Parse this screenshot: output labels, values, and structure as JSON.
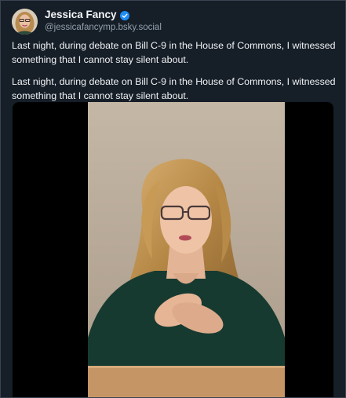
{
  "post": {
    "author": {
      "display_name": "Jessica Fancy",
      "handle": "@jessicafancymp.bsky.social",
      "verified": true
    },
    "paragraphs": [
      "Last night, during debate on Bill C-9 in the House of Commons, I witnessed something that I cannot stay silent about.",
      "Last night, during debate on Bill C-9 in the House of Commons, I witnessed something that I cannot stay silent about."
    ],
    "media": {
      "type": "video",
      "icon": "video-player"
    }
  },
  "colors": {
    "background": "#161e27",
    "text": "#f1f3f5",
    "handle": "#93a0ae",
    "verified_badge": "#1d8cf5",
    "video_letterbox": "#000000"
  }
}
